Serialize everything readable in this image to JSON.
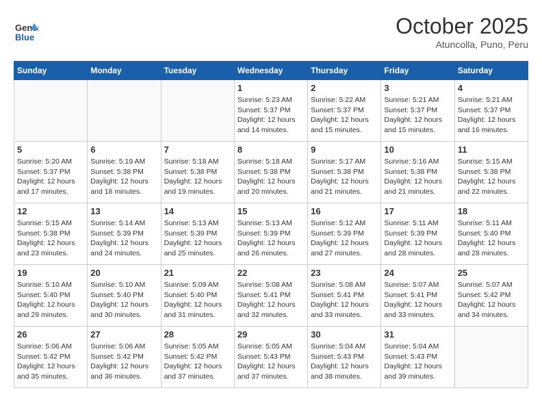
{
  "header": {
    "logo_general": "General",
    "logo_blue": "Blue",
    "month": "October 2025",
    "location": "Atuncolla, Puno, Peru"
  },
  "weekdays": [
    "Sunday",
    "Monday",
    "Tuesday",
    "Wednesday",
    "Thursday",
    "Friday",
    "Saturday"
  ],
  "weeks": [
    [
      {
        "day": "",
        "info": ""
      },
      {
        "day": "",
        "info": ""
      },
      {
        "day": "",
        "info": ""
      },
      {
        "day": "1",
        "info": "Sunrise: 5:23 AM\nSunset: 5:37 PM\nDaylight: 12 hours and 14 minutes."
      },
      {
        "day": "2",
        "info": "Sunrise: 5:22 AM\nSunset: 5:37 PM\nDaylight: 12 hours and 15 minutes."
      },
      {
        "day": "3",
        "info": "Sunrise: 5:21 AM\nSunset: 5:37 PM\nDaylight: 12 hours and 15 minutes."
      },
      {
        "day": "4",
        "info": "Sunrise: 5:21 AM\nSunset: 5:37 PM\nDaylight: 12 hours and 16 minutes."
      }
    ],
    [
      {
        "day": "5",
        "info": "Sunrise: 5:20 AM\nSunset: 5:37 PM\nDaylight: 12 hours and 17 minutes."
      },
      {
        "day": "6",
        "info": "Sunrise: 5:19 AM\nSunset: 5:38 PM\nDaylight: 12 hours and 18 minutes."
      },
      {
        "day": "7",
        "info": "Sunrise: 5:18 AM\nSunset: 5:38 PM\nDaylight: 12 hours and 19 minutes."
      },
      {
        "day": "8",
        "info": "Sunrise: 5:18 AM\nSunset: 5:38 PM\nDaylight: 12 hours and 20 minutes."
      },
      {
        "day": "9",
        "info": "Sunrise: 5:17 AM\nSunset: 5:38 PM\nDaylight: 12 hours and 21 minutes."
      },
      {
        "day": "10",
        "info": "Sunrise: 5:16 AM\nSunset: 5:38 PM\nDaylight: 12 hours and 21 minutes."
      },
      {
        "day": "11",
        "info": "Sunrise: 5:15 AM\nSunset: 5:38 PM\nDaylight: 12 hours and 22 minutes."
      }
    ],
    [
      {
        "day": "12",
        "info": "Sunrise: 5:15 AM\nSunset: 5:38 PM\nDaylight: 12 hours and 23 minutes."
      },
      {
        "day": "13",
        "info": "Sunrise: 5:14 AM\nSunset: 5:39 PM\nDaylight: 12 hours and 24 minutes."
      },
      {
        "day": "14",
        "info": "Sunrise: 5:13 AM\nSunset: 5:39 PM\nDaylight: 12 hours and 25 minutes."
      },
      {
        "day": "15",
        "info": "Sunrise: 5:13 AM\nSunset: 5:39 PM\nDaylight: 12 hours and 26 minutes."
      },
      {
        "day": "16",
        "info": "Sunrise: 5:12 AM\nSunset: 5:39 PM\nDaylight: 12 hours and 27 minutes."
      },
      {
        "day": "17",
        "info": "Sunrise: 5:11 AM\nSunset: 5:39 PM\nDaylight: 12 hours and 28 minutes."
      },
      {
        "day": "18",
        "info": "Sunrise: 5:11 AM\nSunset: 5:40 PM\nDaylight: 12 hours and 28 minutes."
      }
    ],
    [
      {
        "day": "19",
        "info": "Sunrise: 5:10 AM\nSunset: 5:40 PM\nDaylight: 12 hours and 29 minutes."
      },
      {
        "day": "20",
        "info": "Sunrise: 5:10 AM\nSunset: 5:40 PM\nDaylight: 12 hours and 30 minutes."
      },
      {
        "day": "21",
        "info": "Sunrise: 5:09 AM\nSunset: 5:40 PM\nDaylight: 12 hours and 31 minutes."
      },
      {
        "day": "22",
        "info": "Sunrise: 5:08 AM\nSunset: 5:41 PM\nDaylight: 12 hours and 32 minutes."
      },
      {
        "day": "23",
        "info": "Sunrise: 5:08 AM\nSunset: 5:41 PM\nDaylight: 12 hours and 33 minutes."
      },
      {
        "day": "24",
        "info": "Sunrise: 5:07 AM\nSunset: 5:41 PM\nDaylight: 12 hours and 33 minutes."
      },
      {
        "day": "25",
        "info": "Sunrise: 5:07 AM\nSunset: 5:42 PM\nDaylight: 12 hours and 34 minutes."
      }
    ],
    [
      {
        "day": "26",
        "info": "Sunrise: 5:06 AM\nSunset: 5:42 PM\nDaylight: 12 hours and 35 minutes."
      },
      {
        "day": "27",
        "info": "Sunrise: 5:06 AM\nSunset: 5:42 PM\nDaylight: 12 hours and 36 minutes."
      },
      {
        "day": "28",
        "info": "Sunrise: 5:05 AM\nSunset: 5:42 PM\nDaylight: 12 hours and 37 minutes."
      },
      {
        "day": "29",
        "info": "Sunrise: 5:05 AM\nSunset: 5:43 PM\nDaylight: 12 hours and 37 minutes."
      },
      {
        "day": "30",
        "info": "Sunrise: 5:04 AM\nSunset: 5:43 PM\nDaylight: 12 hours and 38 minutes."
      },
      {
        "day": "31",
        "info": "Sunrise: 5:04 AM\nSunset: 5:43 PM\nDaylight: 12 hours and 39 minutes."
      },
      {
        "day": "",
        "info": ""
      }
    ]
  ]
}
